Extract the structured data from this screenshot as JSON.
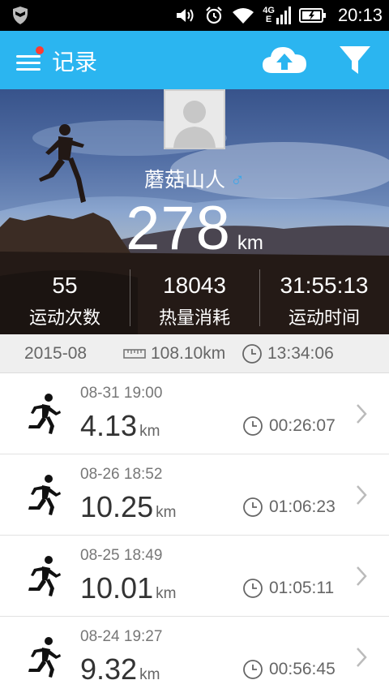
{
  "status_bar": {
    "time": "20:13",
    "network_top": "4G",
    "network_bottom": "E",
    "icons": [
      "shield-icon",
      "volume-icon",
      "alarm-icon",
      "wifi-icon",
      "signal-icon",
      "battery-icon"
    ]
  },
  "app_bar": {
    "title": "记录",
    "icons": [
      "menu-icon",
      "cloud-upload-icon",
      "filter-icon"
    ],
    "accent_color": "#2bb5f0",
    "notification_dot_color": "#ff3b30"
  },
  "profile": {
    "username": "蘑菇山人",
    "gender_symbol": "♂",
    "total_distance": "278",
    "total_unit": "km"
  },
  "stats": [
    {
      "value": "55",
      "label": "运动次数"
    },
    {
      "value": "18043",
      "label": "热量消耗"
    },
    {
      "value": "31:55:13",
      "label": "运动时间"
    }
  ],
  "month_summary": {
    "month": "2015-08",
    "distance": "108.10km",
    "duration": "13:34:06"
  },
  "records": [
    {
      "datetime": "08-31 19:00",
      "distance": "4.13",
      "unit": "km",
      "duration": "00:26:07"
    },
    {
      "datetime": "08-26 18:52",
      "distance": "10.25",
      "unit": "km",
      "duration": "01:06:23"
    },
    {
      "datetime": "08-25 18:49",
      "distance": "10.01",
      "unit": "km",
      "duration": "01:05:11"
    },
    {
      "datetime": "08-24 19:27",
      "distance": "9.32",
      "unit": "km",
      "duration": "00:56:45"
    }
  ]
}
